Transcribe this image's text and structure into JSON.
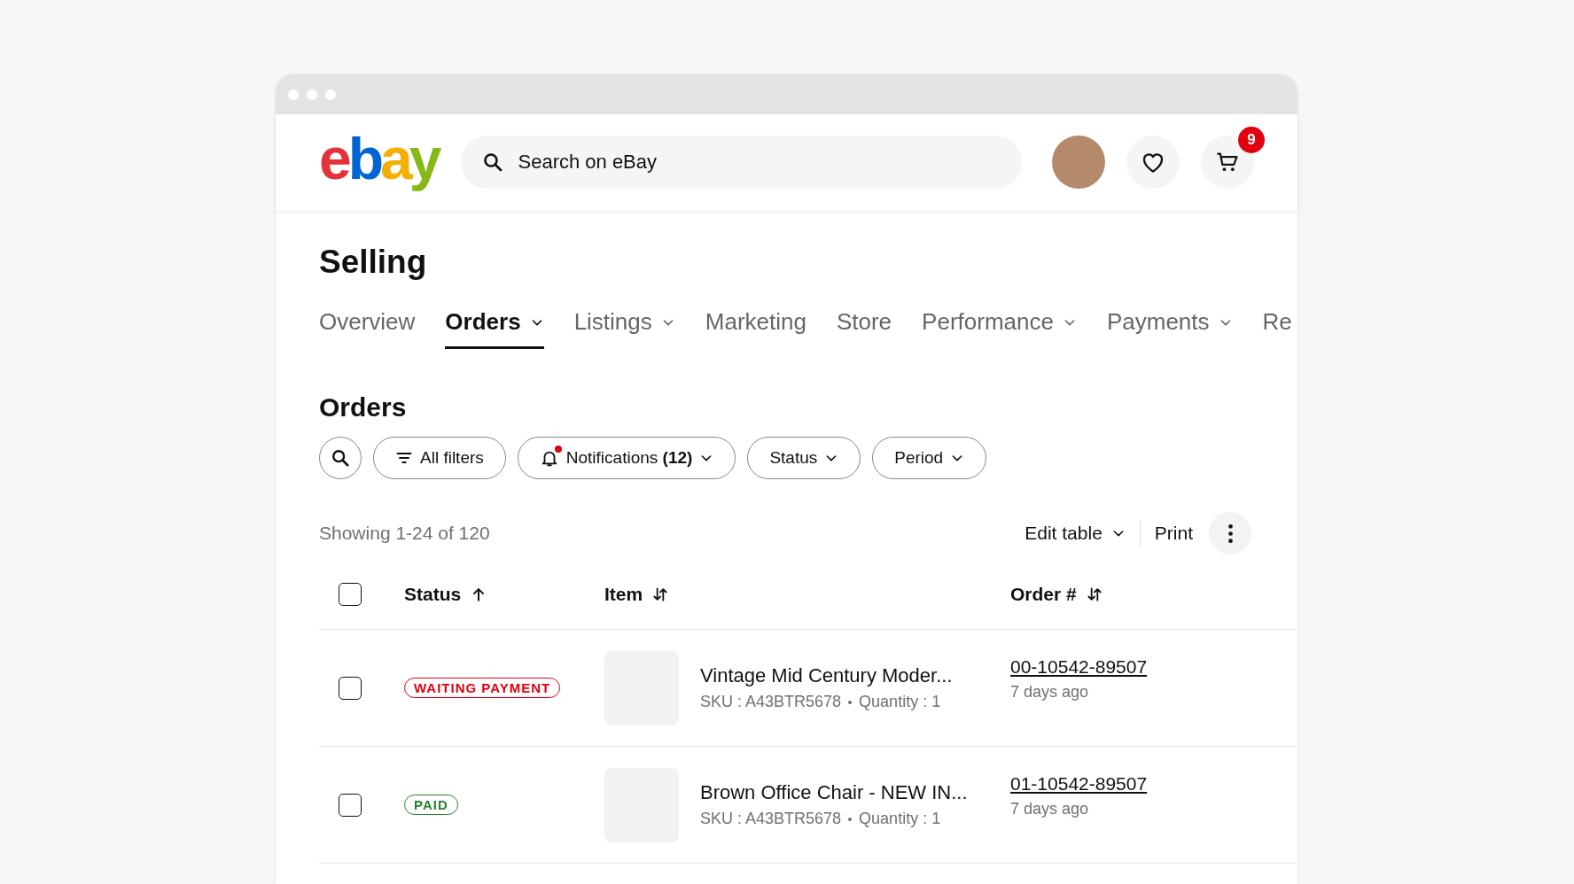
{
  "header": {
    "logo": "ebay",
    "search": {
      "placeholder": "Search on eBay"
    },
    "cart_badge": "9"
  },
  "page_title": "Selling",
  "tabs": [
    {
      "label": "Overview",
      "selected": false,
      "dropdown": false
    },
    {
      "label": "Orders",
      "selected": true,
      "dropdown": true
    },
    {
      "label": "Listings",
      "selected": false,
      "dropdown": true
    },
    {
      "label": "Marketing",
      "selected": false,
      "dropdown": false
    },
    {
      "label": "Store",
      "selected": false,
      "dropdown": false
    },
    {
      "label": "Performance",
      "selected": false,
      "dropdown": true
    },
    {
      "label": "Payments",
      "selected": false,
      "dropdown": true
    },
    {
      "label": "Re",
      "selected": false,
      "dropdown": false
    }
  ],
  "section_title": "Orders",
  "filters": [
    {
      "kind": "search"
    },
    {
      "kind": "filter",
      "label": "All filters",
      "dropdown": false
    },
    {
      "kind": "notifications",
      "label": "Notifications **(12)**",
      "dropdown": true,
      "alert": true
    },
    {
      "kind": "plain",
      "label": "Status",
      "dropdown": true
    },
    {
      "kind": "plain",
      "label": "Period",
      "dropdown": true
    }
  ],
  "results_text": "Showing 1-24 of 120",
  "actions": [
    {
      "label": "Edit table",
      "dropdown": true
    },
    {
      "label": "Print",
      "dropdown": false
    }
  ],
  "table": {
    "select_all_checked": false,
    "columns": [
      {
        "label": "Status",
        "kind": "sort_up"
      },
      {
        "label": "Item",
        "kind": "sort_both"
      },
      {
        "label": "Order #",
        "kind": "sort_both"
      }
    ],
    "rows": [
      {
        "checked": false,
        "status": {
          "label": "WAITING PAYMENT",
          "kind": "waiting"
        },
        "title": "Vintage Mid Century Moder...",
        "sku": "SKU : A43BTR5678",
        "quantity": "Quantity : 1",
        "order": "00-10542-89507",
        "age": "7 days ago"
      },
      {
        "checked": false,
        "status": {
          "label": "PAID",
          "kind": "paid"
        },
        "title": "Brown Office Chair - NEW IN...",
        "sku": "SKU : A43BTR5678",
        "quantity": "Quantity : 1",
        "order": "01-10542-89507",
        "age": "7 days ago"
      }
    ]
  }
}
